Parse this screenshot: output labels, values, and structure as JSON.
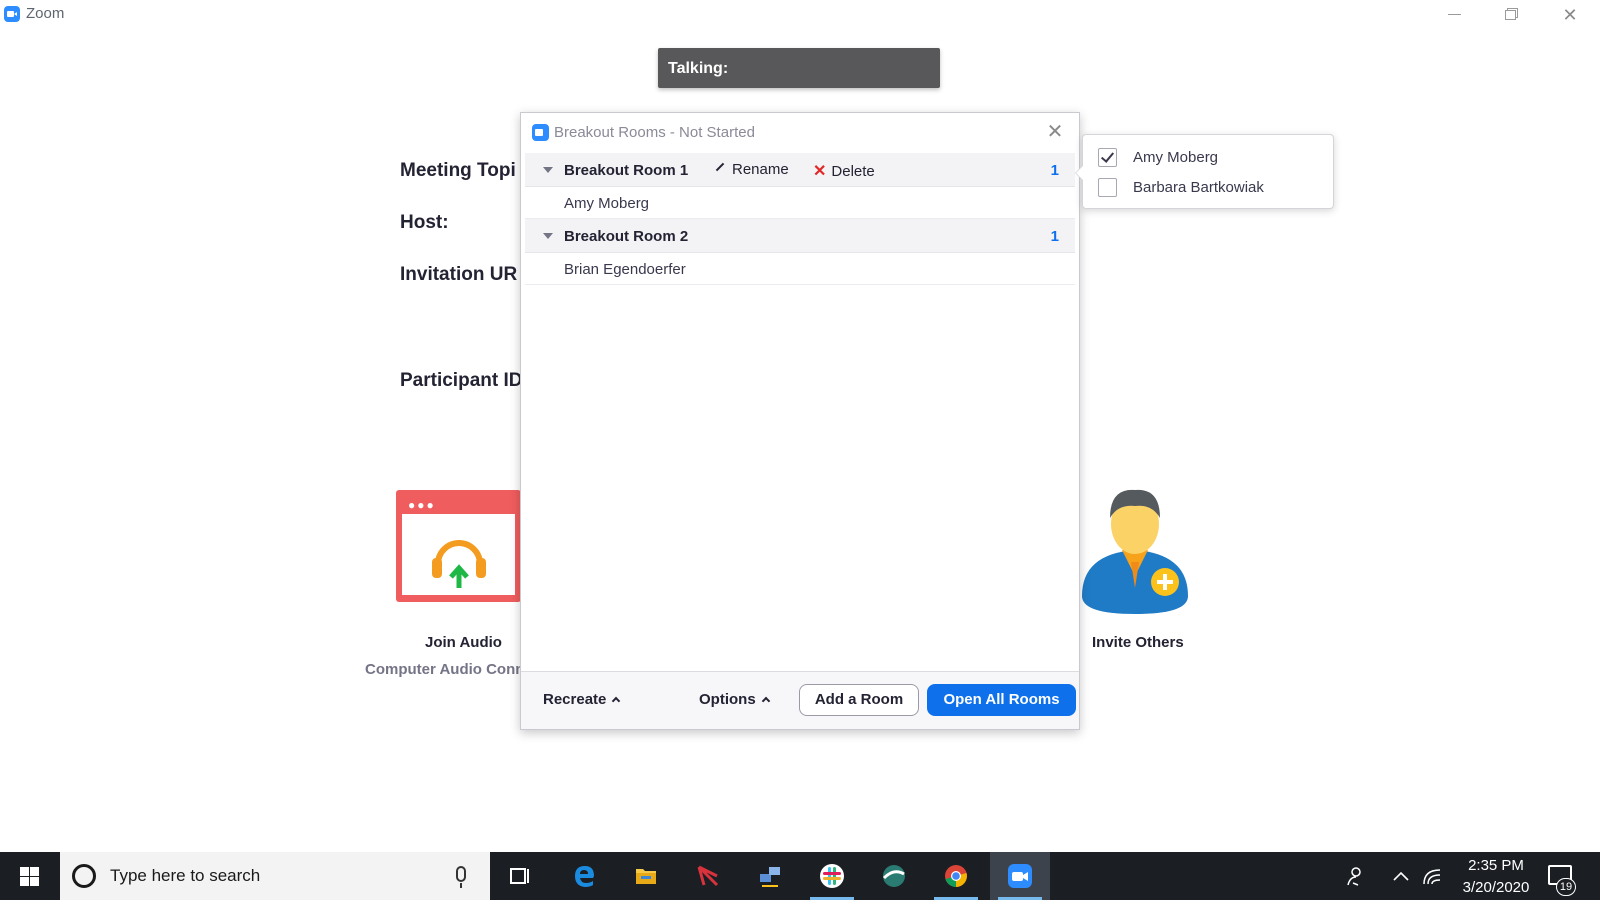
{
  "window": {
    "app_title": "Zoom",
    "controls": {
      "minimize": "minimize",
      "maximize": "restore",
      "close": "✕"
    }
  },
  "talking_bar": {
    "label": "Talking:"
  },
  "meeting_info": {
    "topic_label": "Meeting Topi",
    "host_label": "Host:",
    "url_label": "Invitation UR",
    "participant_id_label": "Participant ID"
  },
  "tiles": {
    "join_audio": {
      "label": "Join Audio",
      "sublabel": "Computer Audio Conn"
    },
    "invite_others": {
      "label": "Invite Others"
    }
  },
  "breakout_dialog": {
    "title": "Breakout Rooms - Not Started",
    "close": "✕",
    "rooms": [
      {
        "name": "Breakout Room 1",
        "count": "1",
        "rename_label": "Rename",
        "delete_label": "Delete",
        "participants": [
          "Amy Moberg"
        ]
      },
      {
        "name": "Breakout Room 2",
        "count": "1",
        "participants": [
          "Brian Egendoerfer"
        ]
      }
    ],
    "footer": {
      "recreate_label": "Recreate",
      "options_label": "Options",
      "add_room_label": "Add a Room",
      "open_all_label": "Open All Rooms"
    }
  },
  "assign_popup": {
    "items": [
      {
        "name": "Amy Moberg",
        "checked": true
      },
      {
        "name": "Barbara Bartkowiak",
        "checked": false
      }
    ]
  },
  "taskbar": {
    "search_placeholder": "Type here to search",
    "apps": [
      "task-view-icon",
      "edge-icon",
      "file-explorer-icon",
      "app-red-icon",
      "network-app-icon",
      "slack-icon",
      "globe-app-icon",
      "chrome-icon",
      "zoom-icon"
    ],
    "time": "2:35 PM",
    "date": "3/20/2020",
    "notification_count": "19"
  },
  "colors": {
    "zoom_blue": "#2d8cff",
    "primary_button": "#0e71eb",
    "join_audio_red": "#f05d5e",
    "taskbar": "#1b1f24"
  }
}
